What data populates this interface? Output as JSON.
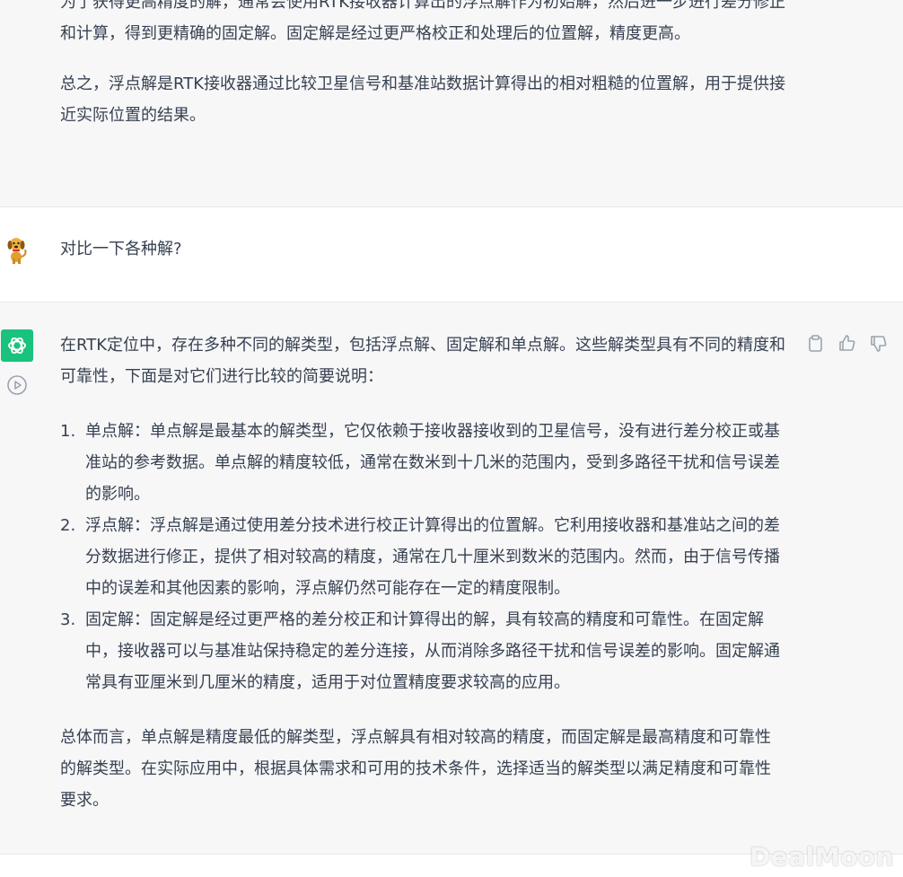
{
  "conversation": {
    "prev_answer": {
      "paragraph1": "为了获得更高精度的解，通常会使用RTK接收器计算出的浮点解作为初始解，然后进一步进行差分修正和计算，得到更精确的固定解。固定解是经过更严格校正和处理后的位置解，精度更高。",
      "paragraph2": "总之，浮点解是RTK接收器通过比较卫星信号和基准站数据计算得出的相对粗糙的位置解，用于提供接近实际位置的结果。"
    },
    "user_message": {
      "text": "对比一下各种解?"
    },
    "answer": {
      "intro": "在RTK定位中，存在多种不同的解类型，包括浮点解、固定解和单点解。这些解类型具有不同的精度和可靠性，下面是对它们进行比较的简要说明：",
      "items": [
        {
          "num": "1.",
          "text": "单点解：单点解是最基本的解类型，它仅依赖于接收器接收到的卫星信号，没有进行差分校正或基准站的参考数据。单点解的精度较低，通常在数米到十几米的范围内，受到多路径干扰和信号误差的影响。"
        },
        {
          "num": "2.",
          "text": "浮点解：浮点解是通过使用差分技术进行校正计算得出的位置解。它利用接收器和基准站之间的差分数据进行修正，提供了相对较高的精度，通常在几十厘米到数米的范围内。然而，由于信号传播中的误差和其他因素的影响，浮点解仍然可能存在一定的精度限制。"
        },
        {
          "num": "3.",
          "text": "固定解：固定解是经过更严格的差分校正和计算得出的解，具有较高的精度和可靠性。在固定解中，接收器可以与基准站保持稳定的差分连接，从而消除多路径干扰和信号误差的影响。固定解通常具有亚厘米到几厘米的精度，适用于对位置精度要求较高的应用。"
        }
      ],
      "summary": "总体而言，单点解是精度最低的解类型，浮点解具有相对较高的精度，而固定解是最高精度和可靠性的解类型。在实际应用中，根据具体需求和可用的技术条件，选择适当的解类型以满足精度和可靠性要求。"
    }
  },
  "icons": {
    "user_avatar": "dog-avatar-icon",
    "assistant_avatar": "openai-logo-icon",
    "play": "play-circle-icon",
    "copy": "clipboard-icon",
    "thumbs_up": "thumbs-up-icon",
    "thumbs_down": "thumbs-down-icon"
  },
  "colors": {
    "assistant_bg": "#f7f7f8",
    "user_bg": "#ffffff",
    "accent_green": "#19c37d",
    "text": "#374151"
  },
  "watermark": "DealMoon"
}
